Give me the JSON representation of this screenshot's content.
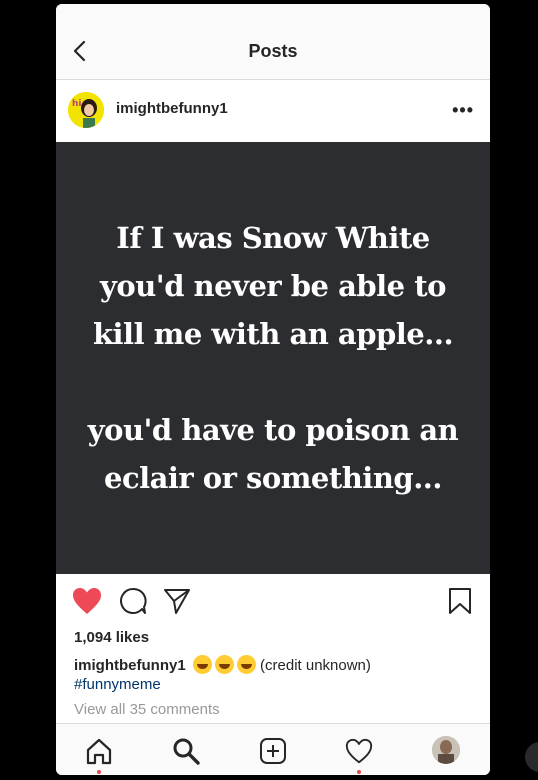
{
  "nav": {
    "title": "Posts"
  },
  "post": {
    "username": "imightbefunny1",
    "quote_lines_1": [
      "If I was Snow White",
      "you'd never be able to",
      "kill me with an apple..."
    ],
    "quote_lines_2": [
      "you'd have to poison an",
      "eclair or something..."
    ],
    "likes": "1,094 likes",
    "caption_user": "imightbefunny1",
    "caption_text": "(credit unknown)",
    "hashtag": "#funnymeme",
    "view_all": "View all 35 comments"
  },
  "colors": {
    "heart": "#ed4956",
    "hashtag": "#003569",
    "image_bg": "#2b2d31"
  },
  "icons": [
    "back-icon",
    "more-icon",
    "heart-icon",
    "comment-icon",
    "share-icon",
    "bookmark-icon",
    "home-icon",
    "search-icon",
    "add-post-icon",
    "activity-icon",
    "profile-avatar"
  ]
}
